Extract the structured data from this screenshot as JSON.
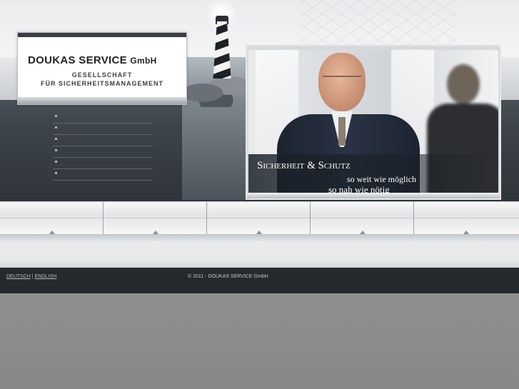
{
  "brand": {
    "name_main": "DOUKAS SERVICE",
    "name_suffix": "GmbH",
    "tagline_line1": "GESELLSCHAFT",
    "tagline_line2": "FÜR SICHERHEITSMANAGEMENT"
  },
  "nav": {
    "items": [
      {
        "label": ""
      },
      {
        "label": ""
      },
      {
        "label": ""
      },
      {
        "label": ""
      },
      {
        "label": ""
      },
      {
        "label": ""
      }
    ]
  },
  "hero": {
    "slogan_title": "Sicherheit & Schutz",
    "slogan_line2": "so weit wie möglich",
    "slogan_line3": "so nah wie nötig"
  },
  "tabs": [
    {
      "label": ""
    },
    {
      "label": ""
    },
    {
      "label": ""
    },
    {
      "label": ""
    },
    {
      "label": ""
    }
  ],
  "footer": {
    "lang_de": "DEUTSCH",
    "lang_sep": "|",
    "lang_en": "ENGLISH",
    "copyright": "© 2011 - DOUKAS SERVICE GmbH"
  },
  "icons": {
    "lighthouse": "lighthouse-icon",
    "nav_bullet": "bullet-icon",
    "tab_arrow": "triangle-up-icon"
  },
  "colors": {
    "footer_bg": "#25292d",
    "page_bg": "#8a8a8a",
    "brand_text": "#1f2226"
  }
}
